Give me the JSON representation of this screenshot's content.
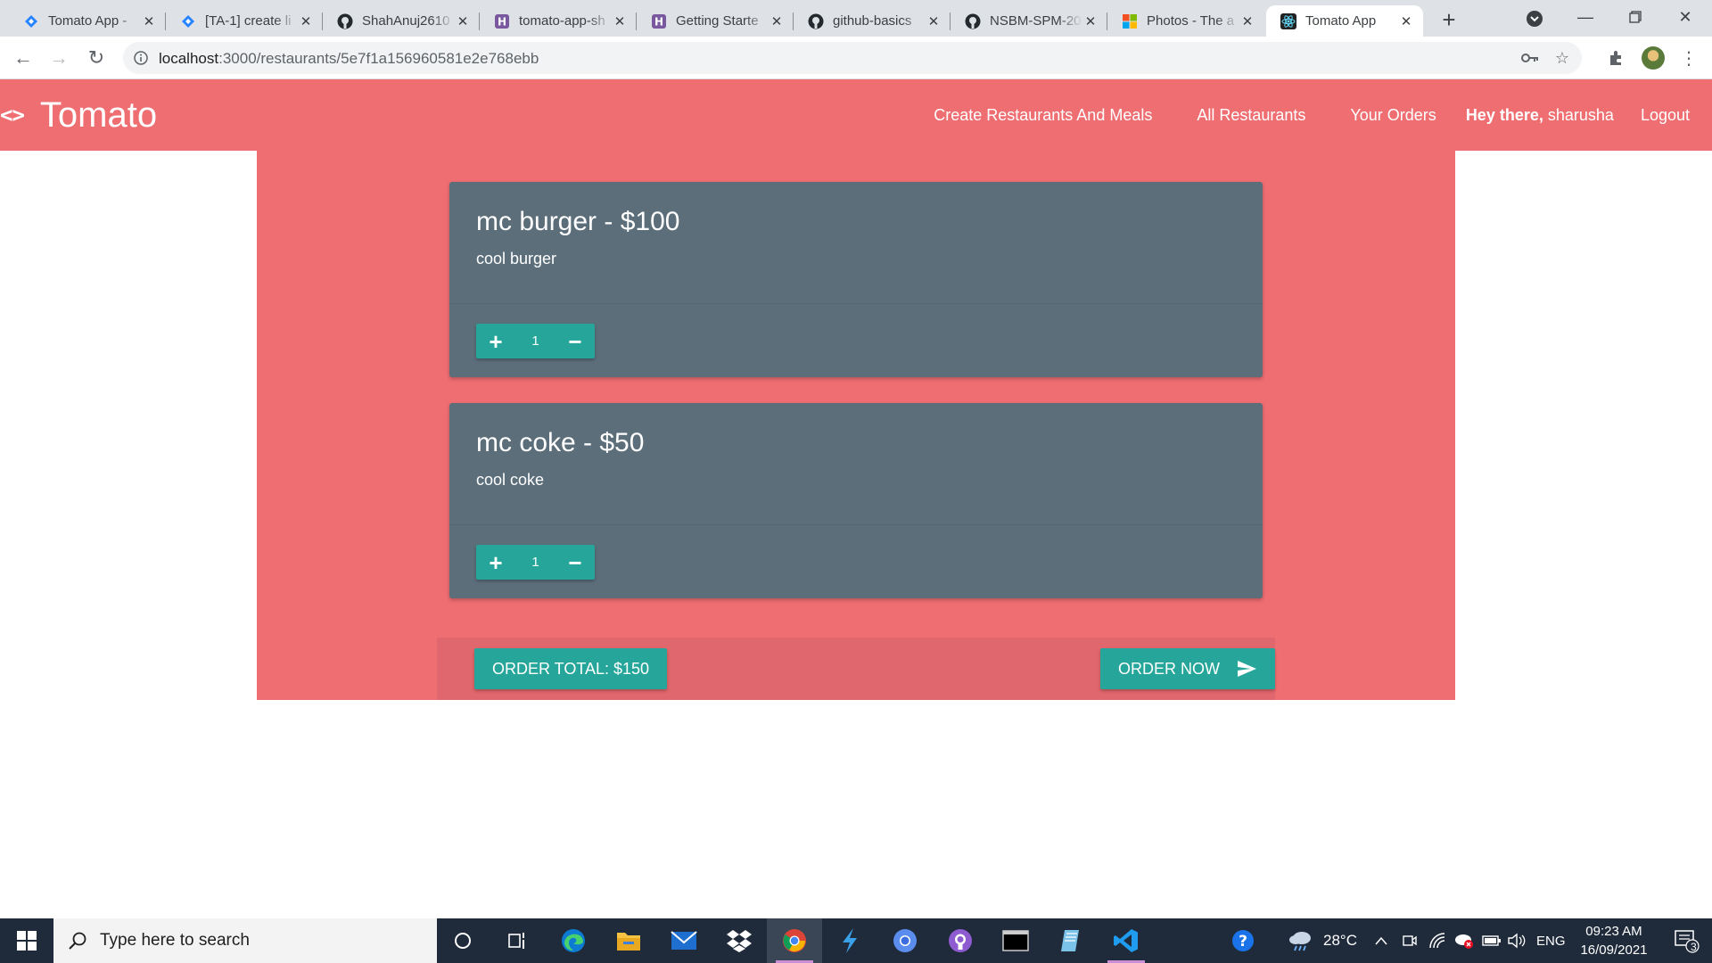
{
  "browser": {
    "tabs": [
      {
        "title": "Tomato App -",
        "favicon": "jira-icon"
      },
      {
        "title": "[TA-1] create li",
        "favicon": "jira-icon"
      },
      {
        "title": "ShahAnuj2610",
        "favicon": "github-icon"
      },
      {
        "title": "tomato-app-sh",
        "favicon": "heroku-icon"
      },
      {
        "title": "Getting Starte",
        "favicon": "heroku-icon"
      },
      {
        "title": "github-basics",
        "favicon": "github-icon"
      },
      {
        "title": "NSBM-SPM-20",
        "favicon": "github-icon"
      },
      {
        "title": "Photos - The a",
        "favicon": "microsoft-icon"
      },
      {
        "title": "Tomato App",
        "favicon": "react-icon",
        "active": true
      }
    ],
    "url_host": "localhost",
    "url_path": ":3000/restaurants/5e7f1a156960581e2e768ebb"
  },
  "app": {
    "brand_icon": "<>",
    "brand_name": "Tomato",
    "nav": {
      "create_label": "Create Restaurants And Meals",
      "all_label": "All Restaurants",
      "orders_label": "Your Orders",
      "greeting_prefix": "Hey there,",
      "username": "sharusha",
      "logout_label": "Logout"
    },
    "meals": [
      {
        "title": "mc burger - $100",
        "description": "cool burger",
        "quantity": "1"
      },
      {
        "title": "mc coke - $50",
        "description": "cool coke",
        "quantity": "1"
      }
    ],
    "order_total_label": "ORDER TOTAL: $150",
    "order_now_label": "ORDER NOW",
    "colors": {
      "primary": "#ef6e72",
      "card": "#5b6e7a",
      "accent": "#26a69a"
    }
  },
  "taskbar": {
    "search_placeholder": "Type here to search",
    "weather": "28°C",
    "language": "ENG",
    "time": "09:23 AM",
    "date": "16/09/2021",
    "notification_count": "3"
  }
}
